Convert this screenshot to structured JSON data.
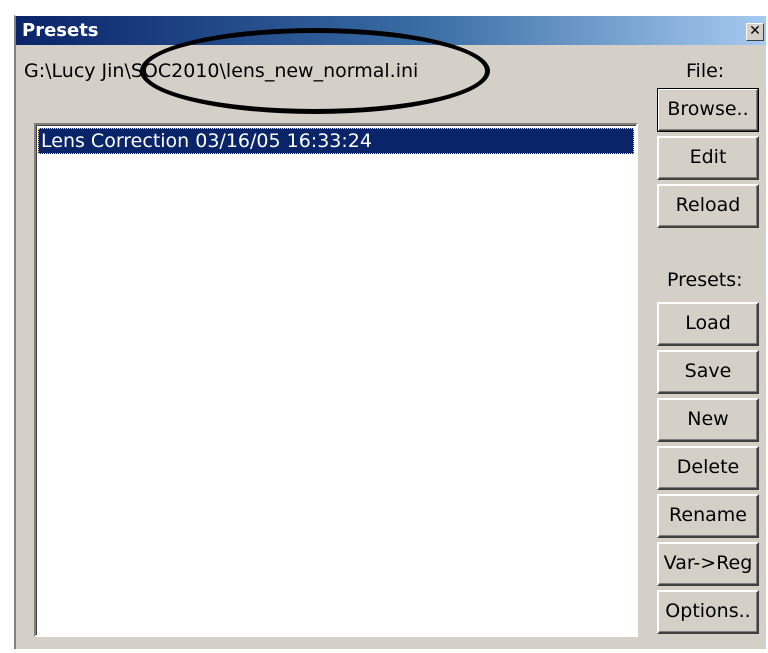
{
  "window": {
    "title": "Presets",
    "close_glyph": "✕",
    "file_path": "G:\\Lucy Jin\\SOC2010\\lens_new_normal.ini"
  },
  "presets_list": {
    "items": [
      {
        "label": "Lens Correction 03/16/05 16:33:24",
        "selected": true
      }
    ]
  },
  "side_panel": {
    "file_label": "File:",
    "file_buttons": [
      "Browse..",
      "Edit",
      "Reload"
    ],
    "presets_label": "Presets:",
    "preset_buttons": [
      "Load",
      "Save",
      "New",
      "Delete",
      "Rename",
      "Var->Reg",
      "Options.."
    ]
  },
  "colors": {
    "title_bar": "#0a246a",
    "selection": "#0a246a",
    "dialog_face": "#d4d0c8"
  }
}
